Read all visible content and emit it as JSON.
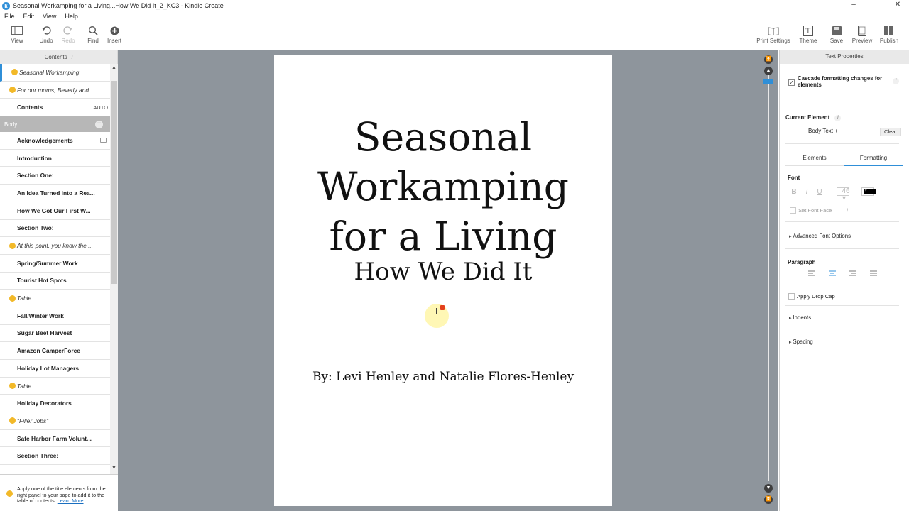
{
  "window": {
    "title": "Seasonal Workamping for a Living...How We Did It_2_KC3 - Kindle Create"
  },
  "menu": [
    "File",
    "Edit",
    "View",
    "Help"
  ],
  "toolbar": {
    "view": "View",
    "undo": "Undo",
    "redo": "Redo",
    "find": "Find",
    "insert": "Insert",
    "print_settings": "Print Settings",
    "theme": "Theme",
    "save": "Save",
    "preview": "Preview",
    "publish": "Publish"
  },
  "left_panel": {
    "header": "Contents",
    "header_info": "i",
    "items": [
      {
        "label": "Seasonal Workamping",
        "style": "italic",
        "dot": true,
        "selected": true
      },
      {
        "label": "For our moms, Beverly and ...",
        "style": "italic",
        "dot": true
      },
      {
        "label": "Contents",
        "style": "bold",
        "badge": "AUTO"
      },
      {
        "section": "Body"
      },
      {
        "label": "Acknowledgements",
        "style": "bold",
        "mini": true
      },
      {
        "label": "Introduction",
        "style": "bold"
      },
      {
        "label": "Section One:",
        "style": "bold"
      },
      {
        "label": "An Idea Turned into a Rea...",
        "style": "bold"
      },
      {
        "label": "How We Got Our First W...",
        "style": "bold"
      },
      {
        "label": "Section Two:",
        "style": "bold"
      },
      {
        "label": "At this point, you know the ...",
        "style": "italic",
        "dot": true
      },
      {
        "label": "Spring/Summer Work",
        "style": "bold"
      },
      {
        "label": "Tourist Hot Spots",
        "style": "bold"
      },
      {
        "label": "Table",
        "style": "italic",
        "dot": true
      },
      {
        "label": "Fall/Winter Work",
        "style": "bold"
      },
      {
        "label": "Sugar Beet Harvest",
        "style": "bold"
      },
      {
        "label": "Amazon CamperForce",
        "style": "bold"
      },
      {
        "label": "Holiday Lot Managers",
        "style": "bold"
      },
      {
        "label": "Table",
        "style": "italic",
        "dot": true
      },
      {
        "label": "Holiday Decorators",
        "style": "bold"
      },
      {
        "label": "\"Filler Jobs\"",
        "style": "italic",
        "dot": true
      },
      {
        "label": "Safe Harbor Farm Volunt...",
        "style": "bold"
      },
      {
        "label": "Section Three:",
        "style": "bold"
      }
    ],
    "footer_text": "Apply one of the title elements from the right panel to your page to add it to the table of contents.",
    "footer_link": "Learn More"
  },
  "page": {
    "title_lines": [
      "Seasonal",
      "Workamping",
      "for a Living"
    ],
    "subtitle": "How We Did It",
    "author": "By: Levi Henley and Natalie Flores-Henley"
  },
  "right_panel": {
    "header": "Text Properties",
    "cascade_label": "Cascade formatting changes for elements",
    "current_element_label": "Current Element",
    "current_element_value": "Body Text +",
    "clear": "Clear",
    "tabs": [
      "Elements",
      "Formatting"
    ],
    "active_tab": "Formatting",
    "font_label": "Font",
    "font_size": "46",
    "font_color": "#000000",
    "set_font_face": "Set Font Face",
    "advanced_font": "Advanced Font Options",
    "paragraph_label": "Paragraph",
    "drop_cap": "Apply Drop Cap",
    "indents": "Indents",
    "spacing": "Spacing"
  },
  "colors": {
    "accent": "#2f8fd8",
    "dot": "#f2b929",
    "canvas": "#8e959c"
  }
}
